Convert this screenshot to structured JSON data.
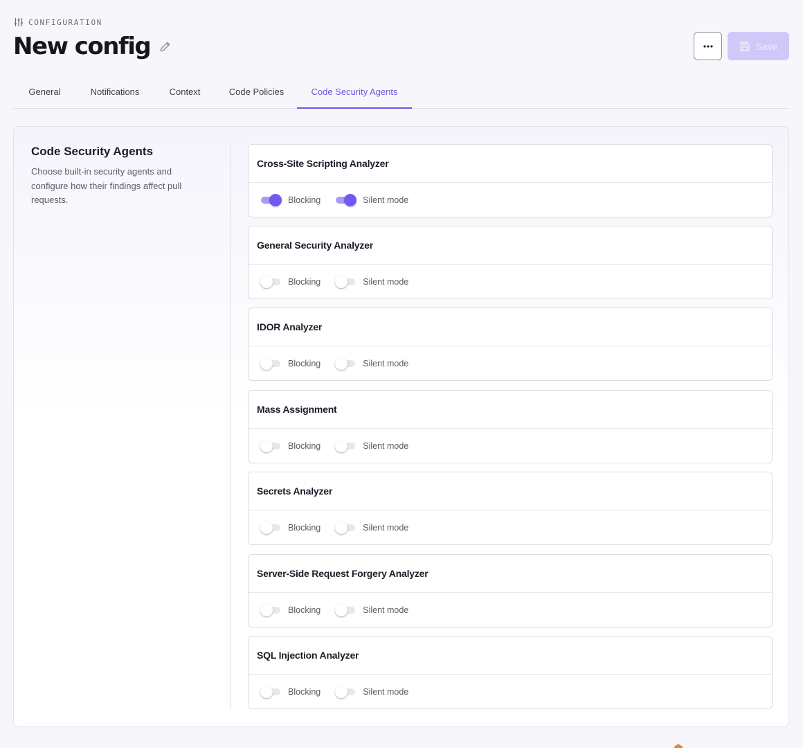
{
  "header": {
    "eyebrow": "CONFIGURATION",
    "title": "New config",
    "more_label": "···",
    "save_label": "Save"
  },
  "tabs": [
    {
      "label": "General",
      "active": false
    },
    {
      "label": "Notifications",
      "active": false
    },
    {
      "label": "Context",
      "active": false
    },
    {
      "label": "Code Policies",
      "active": false
    },
    {
      "label": "Code Security Agents",
      "active": true
    }
  ],
  "section": {
    "title": "Code Security Agents",
    "description": "Choose built-in security agents and configure how their findings affect pull requests."
  },
  "toggle_labels": {
    "blocking": "Blocking",
    "silent": "Silent mode"
  },
  "agents": [
    {
      "name": "Cross-Site Scripting Analyzer",
      "blocking": true,
      "silent": true
    },
    {
      "name": "General Security Analyzer",
      "blocking": false,
      "silent": false
    },
    {
      "name": "IDOR Analyzer",
      "blocking": false,
      "silent": false
    },
    {
      "name": "Mass Assignment",
      "blocking": false,
      "silent": false
    },
    {
      "name": "Secrets Analyzer",
      "blocking": false,
      "silent": false
    },
    {
      "name": "Server-Side Request Forgery Analyzer",
      "blocking": false,
      "silent": false
    },
    {
      "name": "SQL Injection Analyzer",
      "blocking": false,
      "silent": false
    }
  ],
  "colors": {
    "accent": "#6a56e8",
    "toggle_on_knob": "#6f5bf0",
    "toggle_on_track": "#a79bf7",
    "save_disabled_bg": "#cfc9f9"
  },
  "icons": {
    "eyebrow": "sliders-icon",
    "edit": "pencil-icon",
    "more": "more-horizontal-icon",
    "save": "floppy-disk-icon"
  }
}
